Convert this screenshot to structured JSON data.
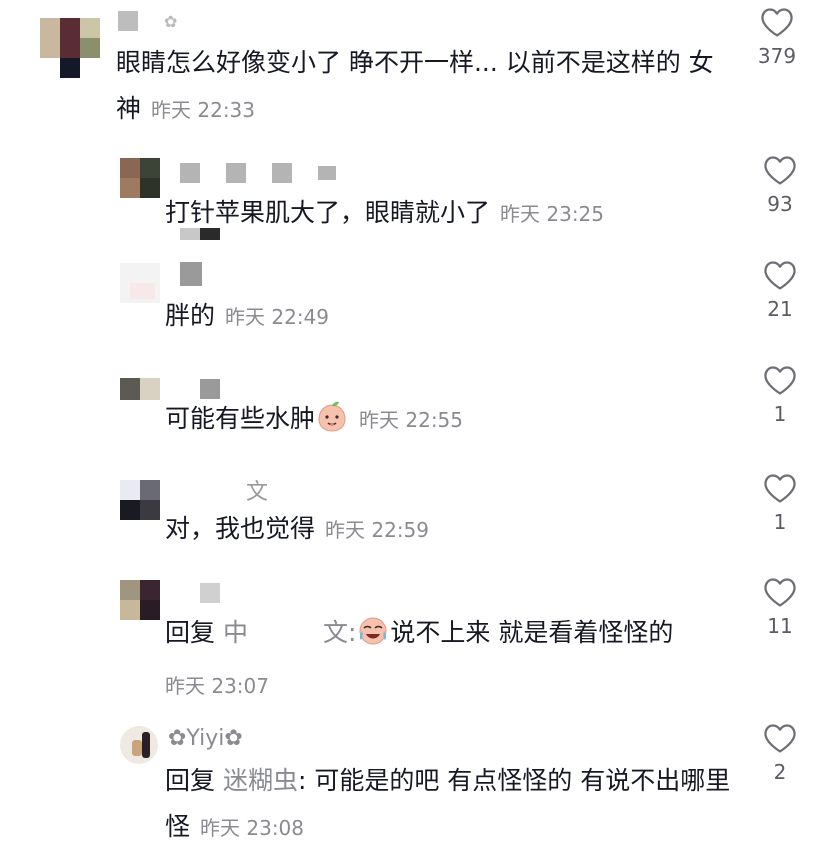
{
  "comments": [
    {
      "username": "",
      "text": "眼睛怎么好像变小了 睁不开一样... 以前不是这样的 女神",
      "time": "昨天 22:33",
      "likes": "379"
    },
    {
      "username": "",
      "text": "打针苹果肌大了，眼睛就小了",
      "time": "昨天 23:25",
      "likes": "93"
    },
    {
      "username": "",
      "text": "胖的",
      "time": "昨天 22:49",
      "likes": "21"
    },
    {
      "username": "",
      "text": "可能有些水肿",
      "emoji": "peach-face-emoji",
      "time": "昨天 22:55",
      "likes": "1"
    },
    {
      "username": "文",
      "text": "对，我也觉得",
      "time": "昨天 22:59",
      "likes": "1"
    },
    {
      "username": "",
      "reply_prefix": "回复",
      "reply_to": "中　　　文:",
      "emoji": "crying-laughing-emoji",
      "text": "说不上来 就是看着怪怪的",
      "time": "昨天 23:07",
      "likes": "11"
    },
    {
      "username": "✿Yiyi✿",
      "reply_prefix": "回复",
      "reply_to": "迷糊虫",
      "text": ": 可能是的吧 有点怪怪的 有说不出哪里怪",
      "time": "昨天 23:08",
      "likes": "2"
    }
  ],
  "colors": {
    "text": "#161823",
    "meta": "#8a8b91",
    "count": "#5b5c63"
  },
  "icons": {
    "like": "heart-outline-icon"
  }
}
